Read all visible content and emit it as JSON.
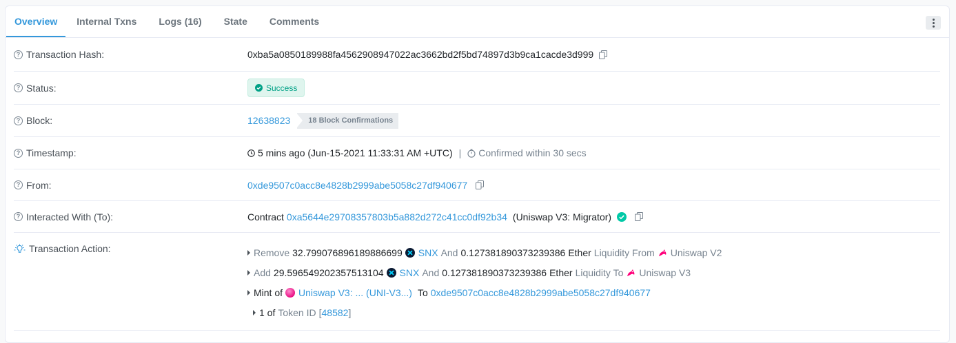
{
  "tabs": [
    {
      "label": "Overview"
    },
    {
      "label": "Internal Txns"
    },
    {
      "label": "Logs (16)"
    },
    {
      "label": "State"
    },
    {
      "label": "Comments"
    }
  ],
  "hash": {
    "label": "Transaction Hash:",
    "value": "0xba5a0850189988fa4562908947022ac3662bd2f5bd74897d3b9ca1cacde3d999"
  },
  "status": {
    "label": "Status:",
    "value": "Success",
    "color": "#00a186"
  },
  "block": {
    "label": "Block:",
    "number": "12638823",
    "confirmations": "18 Block Confirmations"
  },
  "timestamp": {
    "label": "Timestamp:",
    "value": "5 mins ago (Jun-15-2021 11:33:31 AM +UTC)",
    "separator": "|",
    "confirmed": "Confirmed within 30 secs"
  },
  "from": {
    "label": "From:",
    "address": "0xde9507c0acc8e4828b2999abe5058c27df940677"
  },
  "to": {
    "label": "Interacted With (To):",
    "prefix": "Contract",
    "address": "0xa5644e29708357803b5a882d272c41cc0df92b34",
    "name": "(Uniswap V3: Migrator)"
  },
  "action": {
    "label": "Transaction Action:",
    "line1": {
      "verb": "Remove",
      "amount": "32.799076896189886699",
      "token": "SNX",
      "and": "And",
      "eth_amount": "0.127381890373239386",
      "eth": "Ether",
      "liquidity": "Liquidity From",
      "dex": "Uniswap V2"
    },
    "line2": {
      "verb": "Add",
      "amount": "29.596549202357513104",
      "token": "SNX",
      "and": "And",
      "eth_amount": "0.127381890373239386",
      "eth": "Ether",
      "liquidity": "Liquidity To",
      "dex": "Uniswap V3"
    },
    "line3": {
      "verb": "Mint of",
      "token": "Uniswap V3: ... (UNI-V3...)",
      "to": "To",
      "address": "0xde9507c0acc8e4828b2999abe5058c27df940677"
    },
    "line4": {
      "count": "1 of",
      "token_id_label": "Token ID",
      "open": "[",
      "token_id": "48582",
      "close": "]"
    }
  },
  "icons": {
    "question": "question-circle-icon",
    "copy": "copy-icon",
    "check": "check-circle-icon",
    "clock": "clock-icon",
    "timer": "stopwatch-icon",
    "bulb": "lightbulb-icon",
    "snx": "snx-token-icon",
    "unicorn": "uniswap-icon"
  },
  "colors": {
    "accent": "#3498db",
    "success": "#00a186",
    "verified": "#00c9a7",
    "snx": "#00d1ff",
    "uni": "#ff007a"
  }
}
